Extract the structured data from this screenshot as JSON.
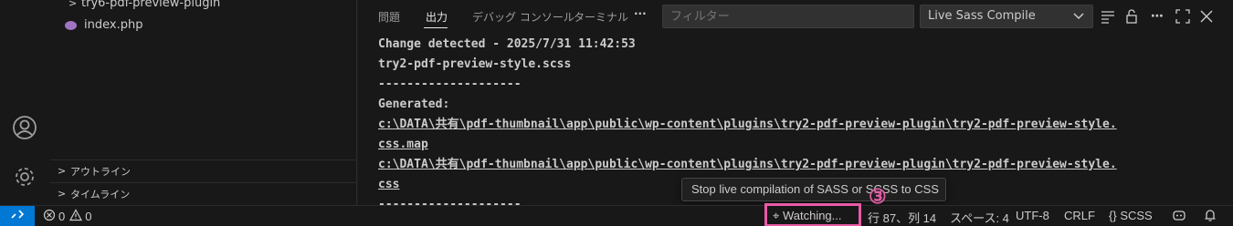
{
  "sidebar": {
    "items": [
      {
        "label": "try6-pdf-preview-plugin"
      },
      {
        "label": "index.php"
      }
    ],
    "sections": [
      {
        "label": "アウトライン"
      },
      {
        "label": "タイムライン"
      }
    ]
  },
  "panel": {
    "tabs": [
      {
        "label": "問題"
      },
      {
        "label": "出力"
      },
      {
        "label": "デバッグ コンソール"
      },
      {
        "label": "ターミナル"
      }
    ],
    "more_label": "···",
    "filter_placeholder": "フィルター",
    "output_channel": "Live Sass Compile",
    "output_lines": [
      "Change detected - 2025/7/31 11:42:53",
      "try2-pdf-preview-style.scss",
      "--------------------",
      "Generated:",
      "c:\\DATA\\共有\\pdf-thumbnail\\app\\public\\wp-content\\plugins\\try2-pdf-preview-plugin\\try2-pdf-preview-style.",
      "css.map",
      "c:\\DATA\\共有\\pdf-thumbnail\\app\\public\\wp-content\\plugins\\try2-pdf-preview-plugin\\try2-pdf-preview-style.",
      "css",
      "--------------------"
    ]
  },
  "tooltip": "Stop live compilation of SASS or SCSS to CSS",
  "callout": "③",
  "status_bar": {
    "errors": "0",
    "warnings": "0",
    "watching": "Watching...",
    "position": "行 87、列 14",
    "spaces": "スペース: 4",
    "encoding": "UTF-8",
    "eol": "CRLF",
    "language": "SCSS"
  },
  "colors": {
    "accent": "#0078d4",
    "highlight": "#e85aa6",
    "php_icon": "#a074c4"
  }
}
